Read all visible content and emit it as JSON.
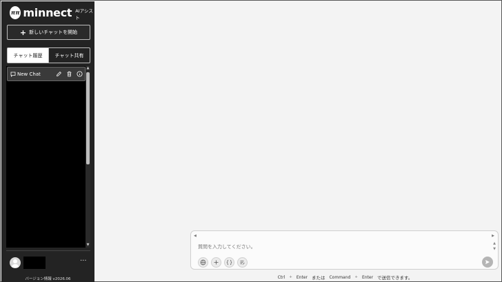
{
  "brand": {
    "mark": "ππ",
    "name": "minnect",
    "subtitle": "AIアシスト"
  },
  "sidebar": {
    "new_chat_button": {
      "icon": "plus-icon",
      "label": "新しいチャットを開始"
    },
    "tabs": [
      {
        "label": "チャット履歴",
        "active": true
      },
      {
        "label": "チャット共有",
        "active": false
      }
    ],
    "chat_items": [
      {
        "icon": "chat-bubble-icon",
        "title": "New Chat",
        "actions": [
          "edit-icon",
          "trash-icon",
          "info-icon"
        ]
      }
    ],
    "user": {
      "avatar": "user-avatar-icon",
      "more": "···"
    },
    "version": "バージョン情報 v2026.06"
  },
  "composer": {
    "placeholder": "質問を入力してください。",
    "tools": [
      "globe-icon",
      "plus-icon",
      "braces-icon",
      "list-edit-icon"
    ],
    "send_icon": "send-icon"
  },
  "shortcut_hint": {
    "key1": "Ctrl",
    "plus": "+",
    "key2": "Enter",
    "or": "または",
    "key3": "Command",
    "key4": "Enter",
    "suffix": "で送信できます。"
  },
  "colors": {
    "sidebar_bg": "#232323",
    "main_bg": "#f3f3f3",
    "accent": "#ffffff"
  }
}
